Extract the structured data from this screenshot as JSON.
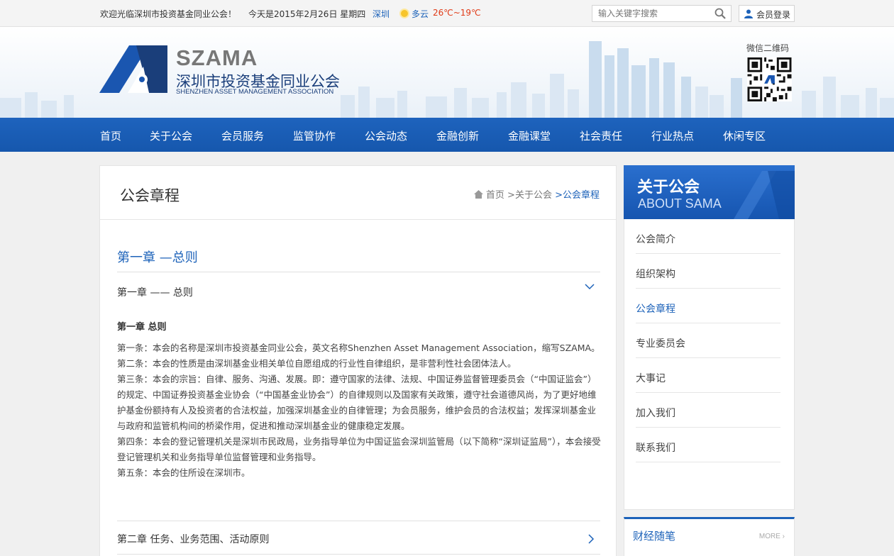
{
  "topbar": {
    "welcome": "欢迎光临深圳市投资基金同业公会！",
    "date": "今天是2015年2月26日 星期四",
    "city": "深圳",
    "weather_icon": "sun-cloud-icon",
    "condition": "多云",
    "temperature": "26℃~19℃",
    "search_placeholder": "输入关键字搜索",
    "login_label": "会员登录"
  },
  "header": {
    "logo_brand": "SZAMA",
    "logo_cn": "深圳市投资基金同业公会",
    "logo_en": "SHENZHEN ASSET MANAGEMENT ASSOCIATION",
    "qr_label": "微信二维码"
  },
  "nav": {
    "items": [
      "首页",
      "关于公会",
      "会员服务",
      "监管协作",
      "公会动态",
      "金融创新",
      "金融课堂",
      "社会责任",
      "行业热点",
      "休闲专区"
    ]
  },
  "main": {
    "page_title": "公会章程",
    "breadcrumb": [
      "首页",
      ">关于公会",
      ">公会章程"
    ],
    "chapter_heading": "第一章 —总则",
    "accordion": [
      {
        "title": "第一章 —— 总则",
        "expanded": true
      },
      {
        "title": "第二章 任务、业务范围、活动原则",
        "expanded": false
      }
    ],
    "section_heading": "第一章 总则",
    "articles": [
      "第一条：本会的名称是深圳市投资基金同业公会，英文名称Shenzhen Asset Management Association，缩写SZAMA。",
      "第二条：本会的性质是由深圳基金业相关单位自愿组成的行业性自律组织，是非营利性社会团体法人。",
      "第三条：本会的宗旨：自律、服务、沟通、发展。即：遵守国家的法律、法规、中国证券监督管理委员会（“中国证监会”）的规定、中国证券投资基金业协会（“中国基金业协会”）的自律规则以及国家有关政策，遵守社会道德风尚，为了更好地维护基金份额持有人及投资者的合法权益，加强深圳基金业的自律管理；为会员服务，维护会员的合法权益；发挥深圳基金业与政府和监管机构间的桥梁作用，促进和推动深圳基金业的健康稳定发展。",
      "第四条：本会的登记管理机关是深圳市民政局，业务指导单位为中国证监会深圳监管局（以下简称“深圳证监局”），本会接受登记管理机关和业务指导单位监督管理和业务指导。",
      "第五条：本会的住所设在深圳市。"
    ]
  },
  "sidebar": {
    "title_cn": "关于公会",
    "title_en": "ABOUT SAMA",
    "items": [
      "公会简介",
      "组织架构",
      "公会章程",
      "专业委员会",
      "大事记",
      "加入我们",
      "联系我们"
    ],
    "active_item": "公会章程",
    "box2_title": "财经随笔",
    "box2_more": "MORE ›"
  },
  "colors": {
    "brand_blue": "#1c62b9",
    "nav_blue": "#1e63bd",
    "temperature_red": "#e03a16"
  }
}
